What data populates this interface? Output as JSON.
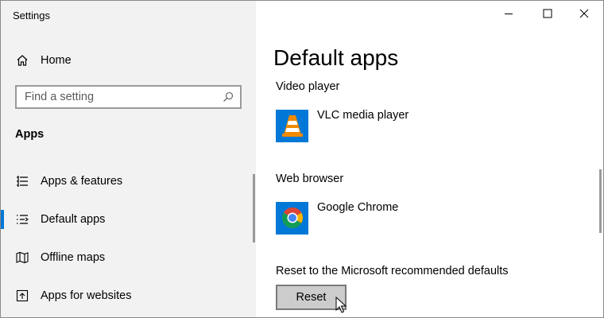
{
  "window": {
    "title": "Settings",
    "controls": [
      "minimize-icon",
      "maximize-icon",
      "close-icon"
    ]
  },
  "sidebar": {
    "home_label": "Home",
    "search": {
      "placeholder": "Find a setting"
    },
    "section_title": "Apps",
    "items": [
      {
        "label": "Apps & features",
        "icon": "apps-features-icon",
        "selected": false
      },
      {
        "label": "Default apps",
        "icon": "default-apps-icon",
        "selected": true
      },
      {
        "label": "Offline maps",
        "icon": "offline-maps-icon",
        "selected": false
      },
      {
        "label": "Apps for websites",
        "icon": "apps-for-websites-icon",
        "selected": false
      }
    ]
  },
  "main": {
    "page_title": "Default apps",
    "video_player": {
      "category": "Video player",
      "app": "VLC media player",
      "icon": "vlc-icon"
    },
    "web_browser": {
      "category": "Web browser",
      "app": "Google Chrome",
      "icon": "chrome-icon"
    },
    "reset": {
      "label": "Reset to the Microsoft recommended defaults",
      "button": "Reset"
    }
  },
  "colors": {
    "accent": "#0078d7",
    "sidebar_bg": "#f2f2f2",
    "button_bg": "#cccccc",
    "vlc_orange": "#f08a00",
    "chrome_red": "#db4437",
    "chrome_yellow": "#f4b400",
    "chrome_green": "#0f9d58",
    "chrome_blue": "#4285f4"
  }
}
